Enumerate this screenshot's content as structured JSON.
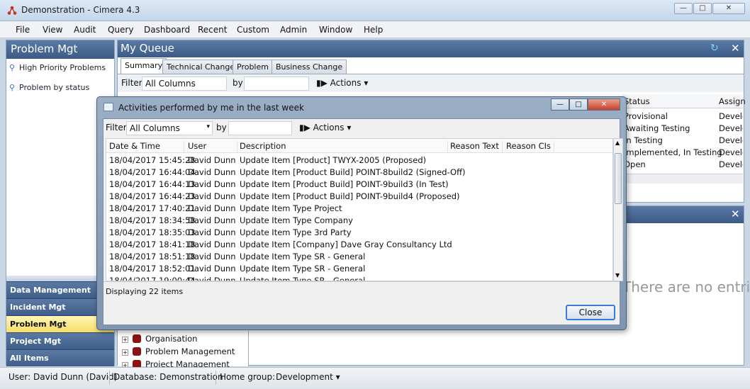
{
  "window": {
    "title": "Demonstration - Cimera 4.3"
  },
  "menu": [
    "File",
    "View",
    "Audit",
    "Query",
    "Dashboard",
    "Recent",
    "Custom",
    "Admin",
    "Window",
    "Help"
  ],
  "left_panel": {
    "title": "Problem Mgt",
    "links": [
      "High Priority Problems",
      "Problem by status"
    ],
    "categories": [
      "Data Management",
      "Incident Mgt",
      "Problem Mgt",
      "Project Mgt",
      "All Items"
    ]
  },
  "queue": {
    "title": "My Queue",
    "tabs": [
      "Summary",
      "Technical Change",
      "Problem",
      "Business Change"
    ],
    "filter_label": "Filter",
    "filter_value": "All Columns",
    "by_label": "by",
    "actions_label": "Actions",
    "columns": [
      "Status",
      "Assign"
    ],
    "rows": [
      [
        "Provisional",
        "Develo"
      ],
      [
        "Awaiting Testing",
        "Develo"
      ],
      [
        "In Testing",
        "Develo"
      ],
      [
        "Implemented, In Testing",
        "Develo"
      ],
      [
        "Open",
        "Develo"
      ]
    ]
  },
  "lower": {
    "no_entries": "There are no entries",
    "tree": [
      "Organisation",
      "Problem Management",
      "Project Management"
    ]
  },
  "dialog": {
    "title": "Activities performed by me in the last week",
    "filter_label": "Filter",
    "filter_value": "All Columns",
    "by_label": "by",
    "actions_label": "Actions",
    "columns": [
      "Date & Time",
      "User",
      "Description",
      "Reason Text",
      "Reason CIs"
    ],
    "rows": [
      [
        "18/04/2017 15:45:28",
        "David Dunn",
        "Update Item [Product] TWYX-2005 (Proposed)"
      ],
      [
        "18/04/2017 16:44:04",
        "David Dunn",
        "Update Item [Product Build] POINT-8build2 (Signed-Off)"
      ],
      [
        "18/04/2017 16:44:13",
        "David Dunn",
        "Update Item [Product Build] POINT-9build3 (In Test)"
      ],
      [
        "18/04/2017 16:44:23",
        "David Dunn",
        "Update Item [Product Build] POINT-9build4 (Proposed)"
      ],
      [
        "18/04/2017 17:40:21",
        "David Dunn",
        "Update Item Type Project"
      ],
      [
        "18/04/2017 18:34:58",
        "David Dunn",
        "Update Item Type Company"
      ],
      [
        "18/04/2017 18:35:03",
        "David Dunn",
        "Update Item Type 3rd Party"
      ],
      [
        "18/04/2017 18:41:18",
        "David Dunn",
        "Update Item [Company] Dave Gray Consultancy Ltd"
      ],
      [
        "18/04/2017 18:51:18",
        "David Dunn",
        "Update Item Type SR - General"
      ],
      [
        "18/04/2017 18:52:01",
        "David Dunn",
        "Update Item Type SR - General"
      ],
      [
        "18/04/2017 19:00:44",
        "David Dunn",
        "Update Item Type SR - General"
      ]
    ],
    "count_text": "Displaying 22 items",
    "close_label": "Close"
  },
  "statusbar": {
    "user": "User: David Dunn (David)",
    "database": "Database: Demonstration",
    "home_group_label": "Home group:",
    "home_group_value": "Development"
  }
}
